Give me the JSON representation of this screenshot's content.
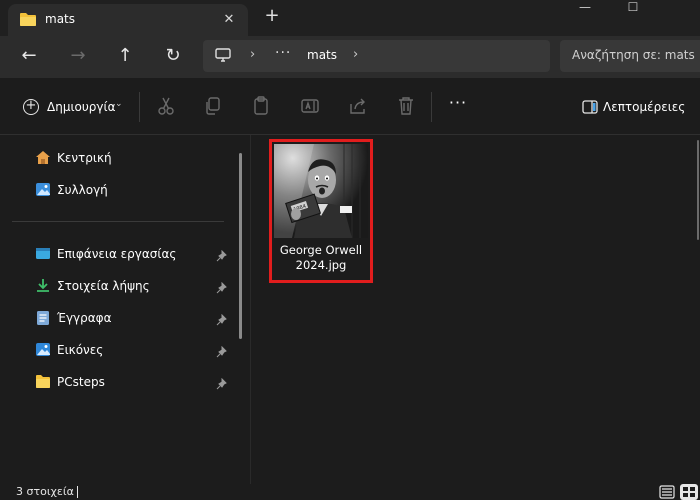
{
  "window": {
    "tab_title": "mats",
    "tab_close": "✕",
    "new_tab": "+",
    "minimize": "—",
    "maximize": "☐"
  },
  "navbar": {
    "back": "←",
    "forward": "→",
    "up": "↑",
    "refresh": "↻",
    "address_more": "···",
    "address_crumb": "mats",
    "search_placeholder": "Αναζήτηση σε: mats"
  },
  "toolbar": {
    "new_label": "Δημιουργία",
    "new_caret": "⌄",
    "more": "···",
    "details_label": "Λεπτομέρειες"
  },
  "sidebar": {
    "home": "Κεντρική",
    "gallery": "Συλλογή",
    "desktop": "Επιφάνεια εργασίας",
    "downloads": "Στοιχεία λήψης",
    "documents": "Έγγραφα",
    "pictures": "Εικόνες",
    "pcsteps": "PCsteps"
  },
  "files": [
    {
      "name_line1": "George Orwell",
      "name_line2": "2024.jpg",
      "book_text": "1984"
    }
  ],
  "status": {
    "count": "3 στοιχεία"
  },
  "colors": {
    "background": "#1c1c1c",
    "titlebar": "#202020",
    "navbar": "#2c2c2c",
    "address": "#383838",
    "folder_yellow": "#f3c13a",
    "selection_border": "#e11d1d",
    "accent_blue": "#4aa3e8",
    "download_green": "#3fbf6a"
  },
  "icons": {
    "tab_folder": "folder-icon",
    "address_pc": "monitor-icon",
    "cut": "scissors-icon",
    "copy": "copy-icon",
    "paste": "clipboard-icon",
    "rename": "rename-icon",
    "share": "share-icon",
    "delete": "trash-icon",
    "details": "details-pane-icon",
    "pin": "pin-icon"
  }
}
